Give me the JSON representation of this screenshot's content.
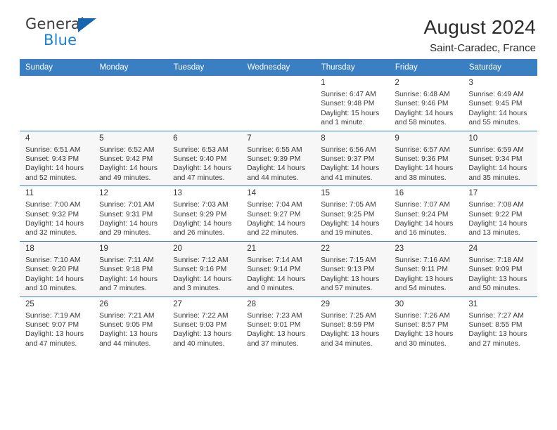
{
  "brand": {
    "line1": "General",
    "line2": "Blue",
    "triangle_color": "#1565b0",
    "accent_color": "#1b7fd4"
  },
  "header": {
    "title": "August 2024",
    "subtitle": "Saint-Caradec, France"
  },
  "calendar": {
    "header_bg": "#3a7fc1",
    "weekday_headers": [
      "Sunday",
      "Monday",
      "Tuesday",
      "Wednesday",
      "Thursday",
      "Friday",
      "Saturday"
    ],
    "weeks": [
      [
        {
          "day": "",
          "detail": ""
        },
        {
          "day": "",
          "detail": ""
        },
        {
          "day": "",
          "detail": ""
        },
        {
          "day": "",
          "detail": ""
        },
        {
          "day": "1",
          "detail": "Sunrise: 6:47 AM\nSunset: 9:48 PM\nDaylight: 15 hours\nand 1 minute."
        },
        {
          "day": "2",
          "detail": "Sunrise: 6:48 AM\nSunset: 9:46 PM\nDaylight: 14 hours\nand 58 minutes."
        },
        {
          "day": "3",
          "detail": "Sunrise: 6:49 AM\nSunset: 9:45 PM\nDaylight: 14 hours\nand 55 minutes."
        }
      ],
      [
        {
          "day": "4",
          "detail": "Sunrise: 6:51 AM\nSunset: 9:43 PM\nDaylight: 14 hours\nand 52 minutes."
        },
        {
          "day": "5",
          "detail": "Sunrise: 6:52 AM\nSunset: 9:42 PM\nDaylight: 14 hours\nand 49 minutes."
        },
        {
          "day": "6",
          "detail": "Sunrise: 6:53 AM\nSunset: 9:40 PM\nDaylight: 14 hours\nand 47 minutes."
        },
        {
          "day": "7",
          "detail": "Sunrise: 6:55 AM\nSunset: 9:39 PM\nDaylight: 14 hours\nand 44 minutes."
        },
        {
          "day": "8",
          "detail": "Sunrise: 6:56 AM\nSunset: 9:37 PM\nDaylight: 14 hours\nand 41 minutes."
        },
        {
          "day": "9",
          "detail": "Sunrise: 6:57 AM\nSunset: 9:36 PM\nDaylight: 14 hours\nand 38 minutes."
        },
        {
          "day": "10",
          "detail": "Sunrise: 6:59 AM\nSunset: 9:34 PM\nDaylight: 14 hours\nand 35 minutes."
        }
      ],
      [
        {
          "day": "11",
          "detail": "Sunrise: 7:00 AM\nSunset: 9:32 PM\nDaylight: 14 hours\nand 32 minutes."
        },
        {
          "day": "12",
          "detail": "Sunrise: 7:01 AM\nSunset: 9:31 PM\nDaylight: 14 hours\nand 29 minutes."
        },
        {
          "day": "13",
          "detail": "Sunrise: 7:03 AM\nSunset: 9:29 PM\nDaylight: 14 hours\nand 26 minutes."
        },
        {
          "day": "14",
          "detail": "Sunrise: 7:04 AM\nSunset: 9:27 PM\nDaylight: 14 hours\nand 22 minutes."
        },
        {
          "day": "15",
          "detail": "Sunrise: 7:05 AM\nSunset: 9:25 PM\nDaylight: 14 hours\nand 19 minutes."
        },
        {
          "day": "16",
          "detail": "Sunrise: 7:07 AM\nSunset: 9:24 PM\nDaylight: 14 hours\nand 16 minutes."
        },
        {
          "day": "17",
          "detail": "Sunrise: 7:08 AM\nSunset: 9:22 PM\nDaylight: 14 hours\nand 13 minutes."
        }
      ],
      [
        {
          "day": "18",
          "detail": "Sunrise: 7:10 AM\nSunset: 9:20 PM\nDaylight: 14 hours\nand 10 minutes."
        },
        {
          "day": "19",
          "detail": "Sunrise: 7:11 AM\nSunset: 9:18 PM\nDaylight: 14 hours\nand 7 minutes."
        },
        {
          "day": "20",
          "detail": "Sunrise: 7:12 AM\nSunset: 9:16 PM\nDaylight: 14 hours\nand 3 minutes."
        },
        {
          "day": "21",
          "detail": "Sunrise: 7:14 AM\nSunset: 9:14 PM\nDaylight: 14 hours\nand 0 minutes."
        },
        {
          "day": "22",
          "detail": "Sunrise: 7:15 AM\nSunset: 9:13 PM\nDaylight: 13 hours\nand 57 minutes."
        },
        {
          "day": "23",
          "detail": "Sunrise: 7:16 AM\nSunset: 9:11 PM\nDaylight: 13 hours\nand 54 minutes."
        },
        {
          "day": "24",
          "detail": "Sunrise: 7:18 AM\nSunset: 9:09 PM\nDaylight: 13 hours\nand 50 minutes."
        }
      ],
      [
        {
          "day": "25",
          "detail": "Sunrise: 7:19 AM\nSunset: 9:07 PM\nDaylight: 13 hours\nand 47 minutes."
        },
        {
          "day": "26",
          "detail": "Sunrise: 7:21 AM\nSunset: 9:05 PM\nDaylight: 13 hours\nand 44 minutes."
        },
        {
          "day": "27",
          "detail": "Sunrise: 7:22 AM\nSunset: 9:03 PM\nDaylight: 13 hours\nand 40 minutes."
        },
        {
          "day": "28",
          "detail": "Sunrise: 7:23 AM\nSunset: 9:01 PM\nDaylight: 13 hours\nand 37 minutes."
        },
        {
          "day": "29",
          "detail": "Sunrise: 7:25 AM\nSunset: 8:59 PM\nDaylight: 13 hours\nand 34 minutes."
        },
        {
          "day": "30",
          "detail": "Sunrise: 7:26 AM\nSunset: 8:57 PM\nDaylight: 13 hours\nand 30 minutes."
        },
        {
          "day": "31",
          "detail": "Sunrise: 7:27 AM\nSunset: 8:55 PM\nDaylight: 13 hours\nand 27 minutes."
        }
      ]
    ]
  }
}
